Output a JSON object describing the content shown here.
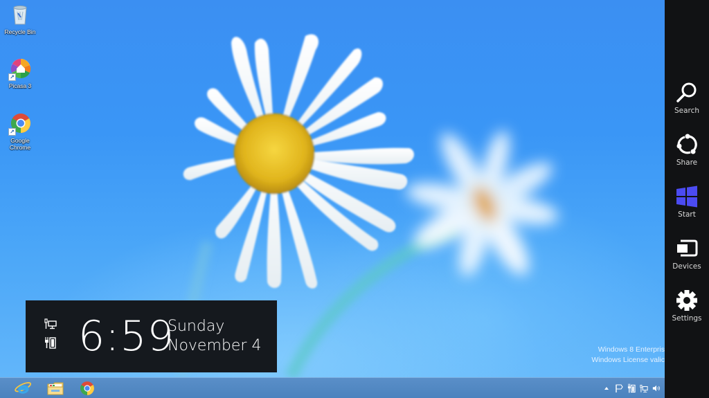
{
  "desktop": {
    "icons": [
      {
        "label": "Recycle Bin",
        "icon": "recycle-bin-icon"
      },
      {
        "label": "Picasa 3",
        "icon": "picasa-icon"
      },
      {
        "label": "Google Chrome",
        "icon": "chrome-icon"
      }
    ],
    "watermark": {
      "line1": "Windows 8 Enterpris",
      "line2": "Windows License valic"
    }
  },
  "clock": {
    "time": "6:59",
    "day": "Sunday",
    "date": "November 4",
    "status_icons": [
      "network-icon",
      "battery-charging-icon"
    ]
  },
  "taskbar": {
    "pinned": [
      {
        "name": "Internet Explorer",
        "icon": "internet-explorer-icon"
      },
      {
        "name": "File Explorer",
        "icon": "file-explorer-icon"
      },
      {
        "name": "Google Chrome",
        "icon": "chrome-icon"
      }
    ],
    "tray": [
      "show-hidden-icons-arrow",
      "action-center-flag-icon",
      "power-icon",
      "network-icon",
      "volume-icon"
    ]
  },
  "charms": {
    "items": [
      {
        "label": "Search",
        "icon": "search-icon"
      },
      {
        "label": "Share",
        "icon": "share-icon"
      },
      {
        "label": "Start",
        "icon": "windows-logo-icon",
        "accent": "#4b4bf2"
      },
      {
        "label": "Devices",
        "icon": "devices-icon"
      },
      {
        "label": "Settings",
        "icon": "settings-gear-icon"
      }
    ],
    "background": "#111214",
    "text_color": "#d8d8d8"
  }
}
